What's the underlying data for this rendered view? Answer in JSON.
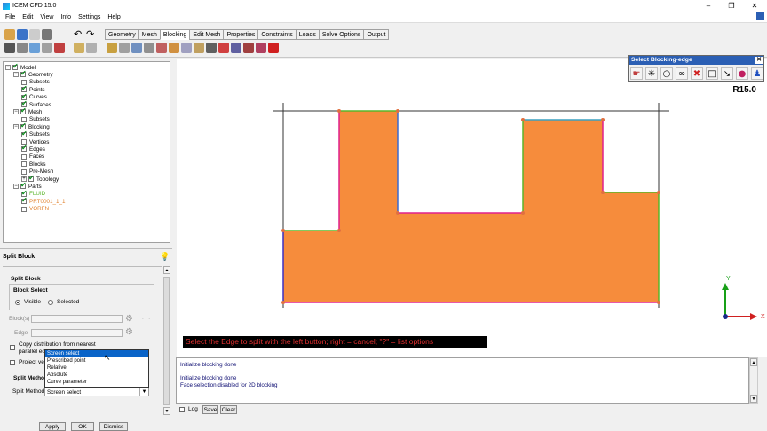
{
  "window": {
    "title": "ICEM CFD 15.0 :",
    "min": "–",
    "max": "❐",
    "close": "✕"
  },
  "menu": [
    "File",
    "Edit",
    "View",
    "Info",
    "Settings",
    "Help"
  ],
  "tabs": [
    "Geometry",
    "Mesh",
    "Blocking",
    "Edit Mesh",
    "Properties",
    "Constraints",
    "Loads",
    "Solve Options",
    "Output"
  ],
  "active_tab": "Blocking",
  "tree": [
    {
      "label": "Model",
      "level": 0,
      "checked": true,
      "exp": "−"
    },
    {
      "label": "Geometry",
      "level": 1,
      "checked": true,
      "exp": "−"
    },
    {
      "label": "Subsets",
      "level": 2,
      "checked": false
    },
    {
      "label": "Points",
      "level": 2,
      "checked": true
    },
    {
      "label": "Curves",
      "level": 2,
      "checked": true
    },
    {
      "label": "Surfaces",
      "level": 2,
      "checked": true
    },
    {
      "label": "Mesh",
      "level": 1,
      "checked": true,
      "exp": "−"
    },
    {
      "label": "Subsets",
      "level": 2,
      "checked": false
    },
    {
      "label": "Blocking",
      "level": 1,
      "checked": true,
      "exp": "−"
    },
    {
      "label": "Subsets",
      "level": 2,
      "checked": true
    },
    {
      "label": "Vertices",
      "level": 2,
      "checked": false
    },
    {
      "label": "Edges",
      "level": 2,
      "checked": true
    },
    {
      "label": "Faces",
      "level": 2,
      "checked": false
    },
    {
      "label": "Blocks",
      "level": 2,
      "checked": false
    },
    {
      "label": "Pre-Mesh",
      "level": 2,
      "checked": false
    },
    {
      "label": "Topology",
      "level": 2,
      "checked": true,
      "exp": "+"
    },
    {
      "label": "Parts",
      "level": 1,
      "checked": true,
      "exp": "−"
    },
    {
      "label": "FLUID",
      "level": 2,
      "checked": true,
      "color": "#5ab52a"
    },
    {
      "label": "PRT0001_1_1",
      "level": 2,
      "checked": true,
      "color": "#e07f2a"
    },
    {
      "label": "VORFN",
      "level": 2,
      "checked": false,
      "color": "#e07f2a"
    }
  ],
  "panel": {
    "title": "Split Block",
    "section": "Split Block",
    "group": "Block Select",
    "radio_visible": "Visible",
    "radio_selected": "Selected",
    "blocks_label": "Block(s)",
    "edge_label": "Edge",
    "copy_dist": "Copy distribution from nearest parallel edge",
    "project_vertices": "Project ver",
    "split_method_head": "Split Metho",
    "split_method_label": "Split Method",
    "split_method_value": "Screen select",
    "dropdown_options": [
      "Screen select",
      "Prescribed point",
      "Relative",
      "Absolute",
      "Curve parameter"
    ],
    "apply": "Apply",
    "ok": "OK",
    "dismiss": "Dismiss"
  },
  "viewport": {
    "status": "Select the Edge to split with the left button; right = cancel; \"?\" = list options",
    "version": "R15.0",
    "axis_x": "X",
    "axis_y": "Y"
  },
  "messages": [
    "Initialize blocking done",
    "",
    "Initialize blocking done",
    "Face selection disabled for 2D blocking"
  ],
  "log": {
    "log_label": "Log",
    "save": "Save",
    "clear": "Clear"
  },
  "popup": {
    "title": "Select Blocking-edge",
    "close": "✕"
  },
  "colors": {
    "fill": "#f68c3c",
    "accent": "#2b5fb4",
    "green": "#5ab52a",
    "magenta": "#e0208c"
  }
}
